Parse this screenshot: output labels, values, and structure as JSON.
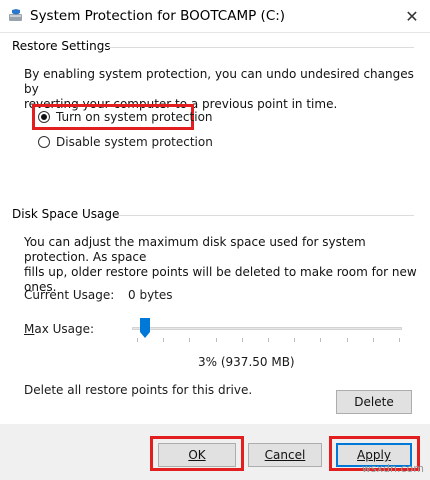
{
  "window": {
    "title": "System Protection for BOOTCAMP (C:)",
    "close_glyph": "✕"
  },
  "restore_settings": {
    "group_label": "Restore Settings",
    "description_line1": "By enabling system protection, you can undo undesired changes by",
    "description_line2": "reverting your computer to a previous point in time.",
    "options": [
      {
        "label": "Turn on system protection",
        "selected": true
      },
      {
        "label": "Disable system protection",
        "selected": false
      }
    ]
  },
  "disk_space": {
    "group_label": "Disk Space Usage",
    "description_line1": "You can adjust the maximum disk space used for system protection. As space",
    "description_line2": "fills up, older restore points will be deleted to make room for new ones.",
    "current_usage_label": "Current Usage:",
    "current_usage_value": "0 bytes",
    "max_usage_label": "Max Usage:",
    "max_usage_percent": 3,
    "max_usage_readout": "3% (937.50 MB)",
    "delete_text": "Delete all restore points for this drive.",
    "delete_button": "Delete"
  },
  "buttons": {
    "ok": "OK",
    "cancel": "Cancel",
    "apply": "Apply"
  },
  "highlight_color": "#e31e1e",
  "accent_color": "#0078d7",
  "icons": {
    "title": "drive-shield-icon",
    "close": "close-icon"
  },
  "watermark": "wsxdn.com"
}
